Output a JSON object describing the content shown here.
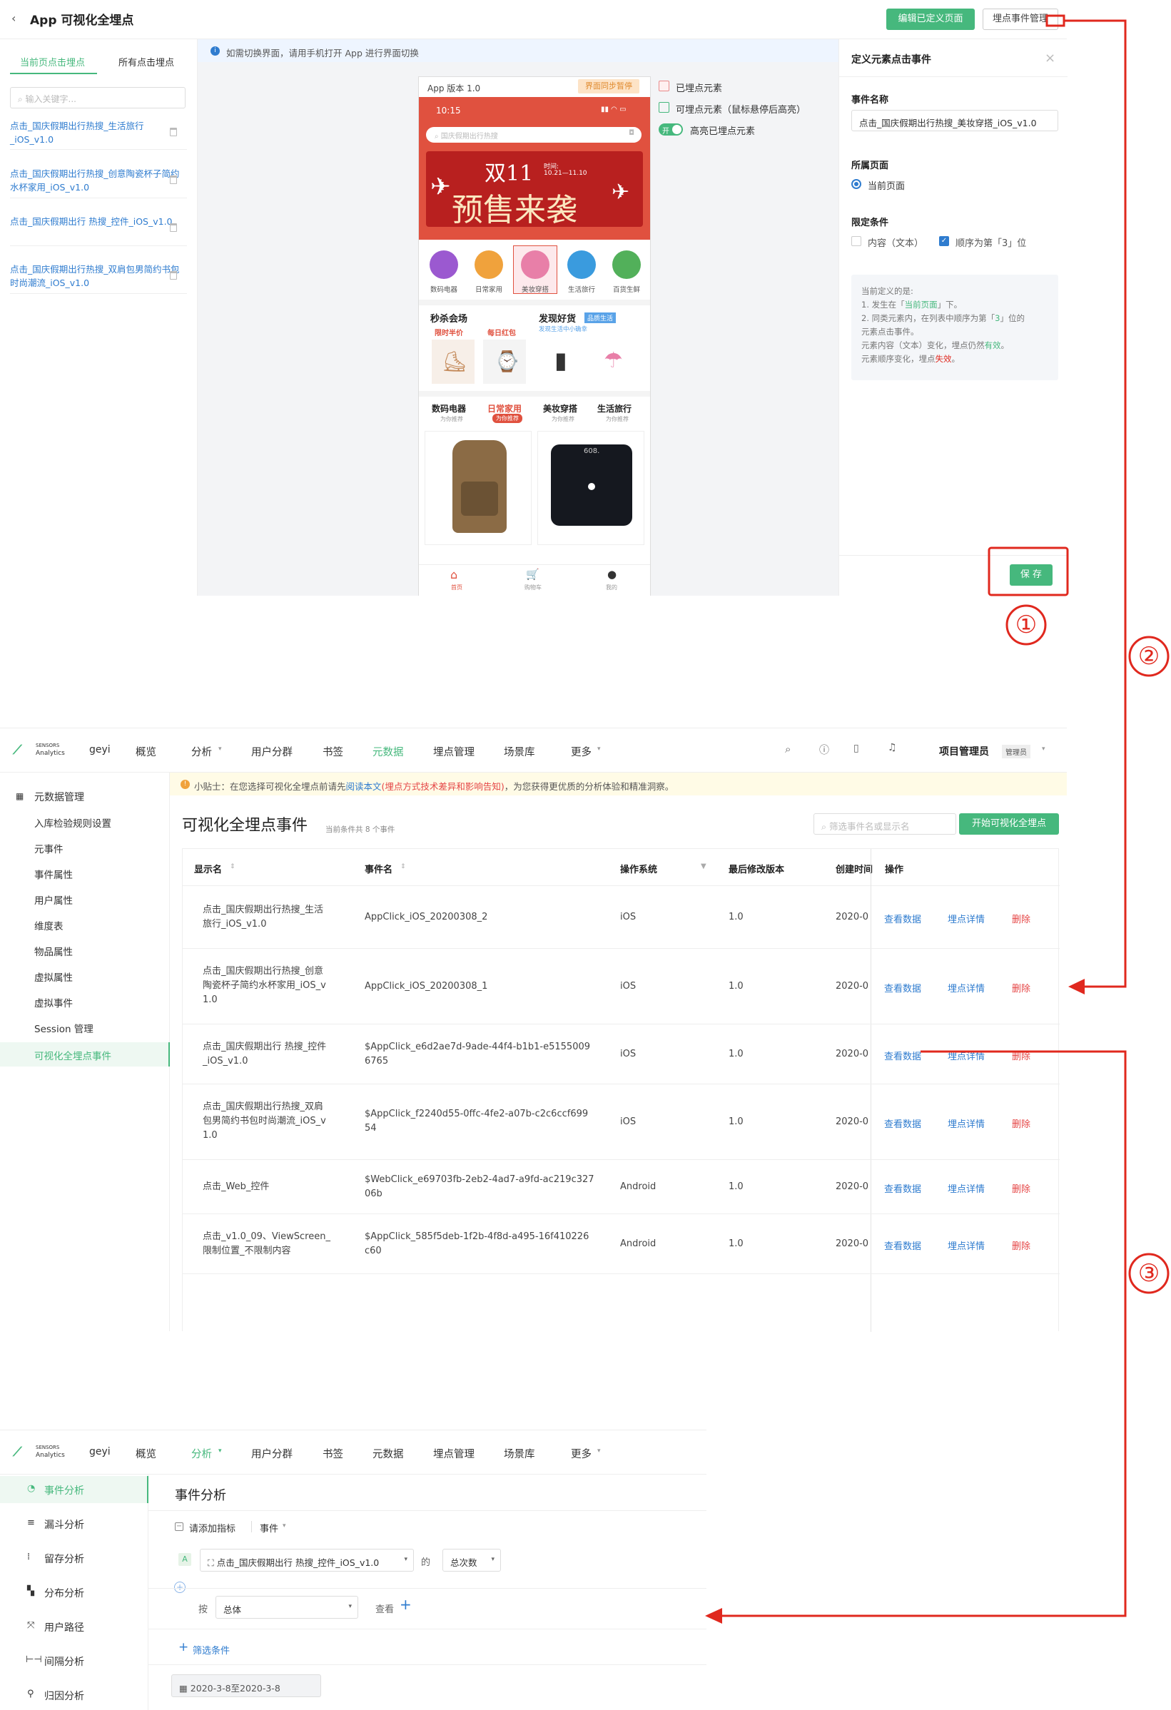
{
  "p1": {
    "title": "App 可视化全埋点",
    "edit_btn": "编辑已定义页面",
    "manage_btn": "埋点事件管理",
    "tab_current": "当前页点击埋点",
    "tab_all": "所有点击埋点",
    "search_placeholder": "输入关键字...",
    "list_items": [
      "点击_国庆假期出行热搜_生活旅行_iOS_v1.0",
      "点击_国庆假期出行热搜_创意陶瓷杯子简约水杯家用_iOS_v1.0",
      "点击_国庆假期出行 热搜_控件_iOS_v1.0",
      "点击_国庆假期出行热搜_双肩包男简约书包时尚潮流_iOS_v1.0"
    ],
    "notice": "如需切换界面，请用手机打开 App 进行界面切换",
    "phone": {
      "app_version": "App 版本 1.0",
      "sync_badge": "界面同步暂停",
      "time": "10:15",
      "search_text": "国庆假期出行热搜",
      "banner_a": "双11",
      "banner_b": "预售来袭",
      "banner_time": "时间:",
      "banner_date": "10.21—11.10",
      "cats": [
        "数码电器",
        "日常家用",
        "美妆穿搭",
        "生活旅行",
        "百货生鲜"
      ],
      "sec_left": "秒杀会场",
      "sec_right": "发现好货",
      "sec_badge": "品质生活",
      "sec_sub": "发现生活中小确幸",
      "tag_a": "限时半价",
      "tag_b": "每日红包",
      "tabs": [
        "数码电器",
        "日常家用",
        "美妆穿搭",
        "生活旅行"
      ],
      "tab_subs": [
        "为你推荐",
        "为你推荐",
        "为你推荐",
        "为你推荐"
      ],
      "scale_text": "608.",
      "bottom": [
        "首页",
        "购物车",
        "我的"
      ]
    },
    "legend_a": "已埋点元素",
    "legend_b": "可埋点元素（鼠标悬停后高亮）",
    "toggle_text": "开",
    "legend_c": "高亮已埋点元素",
    "panel_title": "定义元素点击事件",
    "close": "×",
    "event_name_label": "事件名称",
    "event_name_value": "点击_国庆假期出行热搜_美妆穿搭_iOS_v1.0",
    "page_label": "所属页面",
    "page_option": "当前页面",
    "cond_label": "限定条件",
    "cond_a": "内容（文本）",
    "cond_b": "顺序为第「3」位",
    "desc_1": "当前定义的是:",
    "desc_2a": "1. 发生在「",
    "desc_2b": "当前页面",
    "desc_2c": "」下。",
    "desc_3a": "2. 同类元素内，在列表中顺序为第「",
    "desc_3b": "3",
    "desc_3c": "」位的",
    "desc_4": "元素点击事件。",
    "desc_5a": "元素内容（文本）变化，埋点仍然",
    "desc_5b": "有效",
    "desc_5c": "。",
    "desc_6a": "元素顺序变化，埋点",
    "desc_6b": "失效",
    "desc_6c": "。",
    "save": "保 存"
  },
  "steps": [
    "①",
    "②",
    "③"
  ],
  "p2": {
    "logo_top": "SENSORS",
    "logo_bottom": "Analytics",
    "project": "geyi",
    "nav": [
      "概览",
      "分析",
      "用户分群",
      "书签",
      "元数据",
      "埋点管理",
      "场景库",
      "更多"
    ],
    "user": "项目管理员",
    "role": "管理员",
    "side_title": "元数据管理",
    "side": [
      "入库检验规则设置",
      "元事件",
      "事件属性",
      "用户属性",
      "维度表",
      "物品属性",
      "虚拟属性",
      "虚拟事件",
      "Session 管理",
      "可视化全埋点事件"
    ],
    "tip_a": "小贴士：在您选择可视化全埋点前请先",
    "tip_b": "阅读本文",
    "tip_c": "(埋点方式技术差异和影响告知)",
    "tip_d": "，为您获得更优质的分析体验和精准洞察。",
    "page_title": "可视化全埋点事件",
    "count": "当前条件共 8 个事件",
    "filter_placeholder": "筛选事件名或显示名",
    "start_btn": "开始可视化全埋点",
    "headers": [
      "显示名",
      "事件名",
      "操作系统",
      "最后修改版本",
      "创建时间",
      "操作"
    ],
    "rows": [
      {
        "name": "点击_国庆假期出行热搜_生活\n旅行_iOS_v1.0",
        "event": "AppClick_iOS_20200308_2",
        "os": "iOS",
        "ver": "1.0",
        "time": "2020-0"
      },
      {
        "name": "点击_国庆假期出行热搜_创意\n陶瓷杯子简约水杯家用_iOS_v\n1.0",
        "event": "AppClick_iOS_20200308_1",
        "os": "iOS",
        "ver": "1.0",
        "time": "2020-0"
      },
      {
        "name": "点击_国庆假期出行 热搜_控件\n_iOS_v1.0",
        "event": "$AppClick_e6d2ae7d-9ade-44f4-b1b1-e5155009\n6765",
        "os": "iOS",
        "ver": "1.0",
        "time": "2020-0"
      },
      {
        "name": "点击_国庆假期出行热搜_双肩\n包男简约书包时尚潮流_iOS_v\n1.0",
        "event": "$AppClick_f2240d55-0ffc-4fe2-a07b-c2c6ccf699\n54",
        "os": "iOS",
        "ver": "1.0",
        "time": "2020-0"
      },
      {
        "name": "点击_Web_控件",
        "event": "$WebClick_e69703fb-2eb2-4ad7-a9fd-ac219c327\n06b",
        "os": "Android",
        "ver": "1.0",
        "time": "2020-0"
      },
      {
        "name": "点击_v1.0_09、ViewScreen_\n限制位置_不限制内容",
        "event": "$AppClick_585f5deb-1f2b-4f8d-a495-16f410226\nc60",
        "os": "Android",
        "ver": "1.0",
        "time": "2020-0"
      }
    ],
    "act_view": "查看数据",
    "act_detail": "埋点详情",
    "act_delete": "删除"
  },
  "p3": {
    "page_title": "事件分析",
    "side": [
      "事件分析",
      "漏斗分析",
      "留存分析",
      "分布分析",
      "用户路径",
      "间隔分析",
      "归因分析"
    ],
    "add_metric": "请添加指标",
    "event_dd": "事件",
    "metric_letter": "A",
    "metric_event": "点击_国庆假期出行 热搜_控件_iOS_v1.0",
    "of": "的",
    "agg": "总次数",
    "by": "按",
    "by_val": "总体",
    "view": "查看",
    "filter": "筛选条件",
    "date": "2020-3-8至2020-3-8"
  },
  "colors": {
    "accent": "#46b87d",
    "link": "#2f7ccf",
    "annot": "#e0281e"
  }
}
